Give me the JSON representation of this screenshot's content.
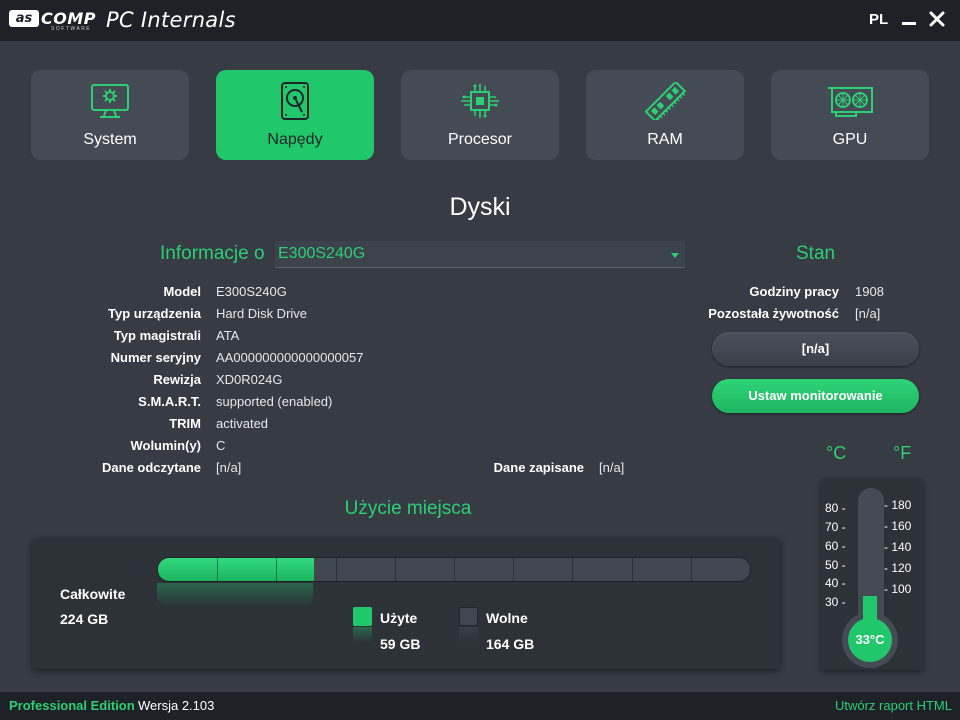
{
  "app": {
    "logo_mark": "as",
    "logo_word": "COMP",
    "logo_sub": "SOFTWARE",
    "title": "PC Internals",
    "language": "PL"
  },
  "tabs": [
    {
      "label": "System",
      "icon": "monitor-gear-icon",
      "active": false
    },
    {
      "label": "Napędy",
      "icon": "hard-drive-icon",
      "active": true
    },
    {
      "label": "Procesor",
      "icon": "cpu-chip-icon",
      "active": false
    },
    {
      "label": "RAM",
      "icon": "ram-stick-icon",
      "active": false
    },
    {
      "label": "GPU",
      "icon": "graphics-card-icon",
      "active": false
    }
  ],
  "page": {
    "title": "Dyski"
  },
  "info": {
    "label": "Informacje o",
    "selected_drive": "E300S240G",
    "props": [
      {
        "key": "Model",
        "value": "E300S240G"
      },
      {
        "key": "Typ urządzenia",
        "value": "Hard Disk Drive"
      },
      {
        "key": "Typ magistrali",
        "value": "ATA"
      },
      {
        "key": "Numer seryjny",
        "value": "AA000000000000000057"
      },
      {
        "key": "Rewizja",
        "value": "XD0R024G"
      },
      {
        "key": "S.M.A.R.T.",
        "value": "supported (enabled)"
      },
      {
        "key": "TRIM",
        "value": "activated"
      },
      {
        "key": "Wolumin(y)",
        "value": "C"
      },
      {
        "key": "Dane odczytane",
        "value": "[n/a]"
      }
    ],
    "written": {
      "key": "Dane zapisane",
      "value": "[n/a]"
    }
  },
  "status": {
    "title": "Stan",
    "hours_key": "Godziny pracy",
    "hours_value": "1908",
    "life_key": "Pozostała żywotność",
    "life_value": "[n/a]",
    "health_bar_text": "[n/a]",
    "monitor_button": "Ustaw monitorowanie"
  },
  "usage": {
    "title": "Użycie miejsca",
    "total_label": "Całkowite",
    "total_value": "224 GB",
    "used_label": "Użyte",
    "used_value": "59 GB",
    "free_label": "Wolne",
    "free_value": "164 GB",
    "used_fraction": 0.264
  },
  "temperature": {
    "c_label": "°C",
    "f_label": "°F",
    "celsius_ticks": [
      "80 -",
      "70 -",
      "60 -",
      "50 -",
      "40 -",
      "30 -"
    ],
    "fahrenheit_ticks": [
      "- 180",
      "- 160",
      "- 140",
      "- 120",
      "- 100"
    ],
    "current": "33°C",
    "current_value_c": 33
  },
  "footer": {
    "edition": "Professional Edition",
    "version": "Wersja 2.103",
    "report_link": "Utwórz raport HTML"
  },
  "colors": {
    "accent": "#21c86b",
    "background": "#363b44",
    "bar": "#1e2228"
  }
}
